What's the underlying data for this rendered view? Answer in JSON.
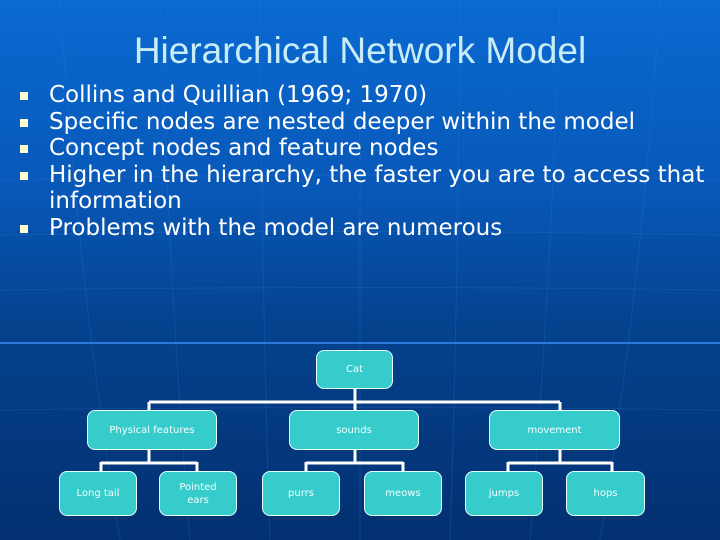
{
  "slide": {
    "title": "Hierarchical Network Model",
    "bullets": [
      "Collins and Quillian (1969; 1970)",
      "Specific nodes are nested deeper within the model",
      "Concept nodes and feature nodes",
      "Higher in the hierarchy, the faster you are to access that information",
      "Problems with the model are numerous"
    ]
  },
  "diagram": {
    "root": "Cat",
    "level1": [
      "Physical features",
      "sounds",
      "movement"
    ],
    "level2": [
      [
        "Long tail",
        "Pointed ears"
      ],
      [
        "purrs",
        "meows"
      ],
      [
        "jumps",
        "hops"
      ]
    ]
  },
  "colors": {
    "node_fill": "#36cccc",
    "title": "#c8ecf8",
    "bullet_square": "#fffbd0"
  }
}
